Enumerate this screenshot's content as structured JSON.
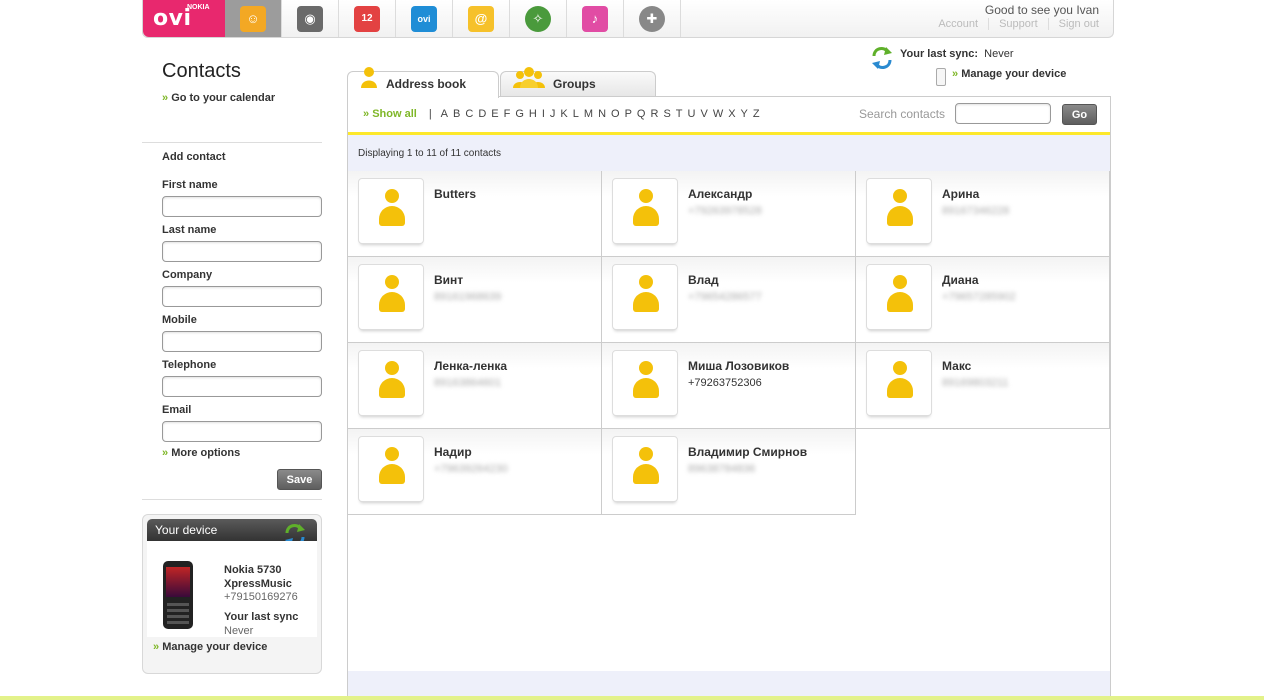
{
  "header": {
    "logo_text": "ovi",
    "logo_brand": "NOKIA",
    "greeting": "Good to see you Ivan",
    "links": [
      "Account",
      "Support",
      "Sign out"
    ],
    "nav": [
      {
        "name": "contacts",
        "icon": "contacts-icon",
        "glyph": "☺",
        "color": "#f3a824",
        "active": true
      },
      {
        "name": "photos",
        "icon": "camera-icon",
        "glyph": "◉",
        "color": "#6a6a6a",
        "active": false
      },
      {
        "name": "calendar",
        "icon": "calendar-icon",
        "glyph": "12",
        "color": "#e34242",
        "active": false
      },
      {
        "name": "store",
        "icon": "store-icon",
        "glyph": "ovi",
        "color": "#1f8dd6",
        "active": false
      },
      {
        "name": "mail",
        "icon": "mail-icon",
        "glyph": "@",
        "color": "#f6c12a",
        "active": false
      },
      {
        "name": "maps",
        "icon": "compass-icon",
        "glyph": "✧",
        "color": "#4a9a3c",
        "active": false
      },
      {
        "name": "music",
        "icon": "music-icon",
        "glyph": "♪",
        "color": "#e14ca4",
        "active": false
      },
      {
        "name": "games",
        "icon": "gamepad-icon",
        "glyph": "✚",
        "color": "#888888",
        "active": false
      }
    ]
  },
  "sidebar": {
    "title": "Contacts",
    "calendar_link": "Go to your calendar",
    "chevron": "»",
    "form_title": "Add contact",
    "fields": [
      "First name",
      "Last name",
      "Company",
      "Mobile",
      "Telephone",
      "Email"
    ],
    "more_options": "More options",
    "save_label": "Save"
  },
  "device": {
    "heading": "Your device",
    "name_line1": "Nokia 5730",
    "name_line2": "XpressMusic",
    "number": "+79150169276",
    "sync_label": "Your last sync",
    "sync_value": "Never",
    "manage": "Manage your device"
  },
  "sync": {
    "label": "Your last sync:",
    "value": "Never",
    "manage": "Manage your device"
  },
  "tabs": [
    {
      "label": "Address book",
      "active": true
    },
    {
      "label": "Groups",
      "active": false
    }
  ],
  "filter": {
    "show_all": "Show all",
    "separator": "|",
    "letters": [
      "A",
      "B",
      "C",
      "D",
      "E",
      "F",
      "G",
      "H",
      "I",
      "J",
      "K",
      "L",
      "M",
      "N",
      "O",
      "P",
      "Q",
      "R",
      "S",
      "T",
      "U",
      "V",
      "W",
      "X",
      "Y",
      "Z"
    ],
    "search_label": "Search contacts",
    "search_value": "",
    "go_label": "Go"
  },
  "status": "Displaying 1 to 11 of 11 contacts",
  "contacts": [
    {
      "name": "Butters",
      "phone": "",
      "blurred": false
    },
    {
      "name": "Александр",
      "phone": "+79263978528",
      "blurred": true
    },
    {
      "name": "Арина",
      "phone": "89167346228",
      "blurred": true
    },
    {
      "name": "Винт",
      "phone": "89161968639",
      "blurred": true
    },
    {
      "name": "Влад",
      "phone": "+79654286577",
      "blurred": true
    },
    {
      "name": "Диана",
      "phone": "+79657285902",
      "blurred": true
    },
    {
      "name": "Ленка-ленка",
      "phone": "89163864601",
      "blurred": true
    },
    {
      "name": "Миша Лозовиков",
      "phone": "+79263752306",
      "blurred": false
    },
    {
      "name": "Макс",
      "phone": "89169803211",
      "blurred": true
    },
    {
      "name": "Надир",
      "phone": "+79639264230",
      "blurred": true
    },
    {
      "name": "Владимир Смирнов",
      "phone": "89638784836",
      "blurred": true
    }
  ]
}
